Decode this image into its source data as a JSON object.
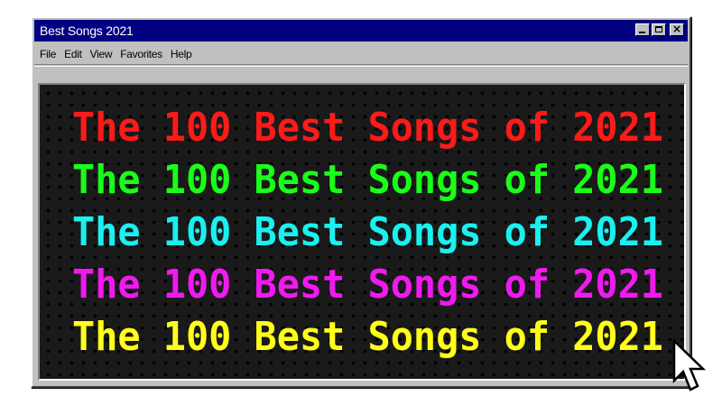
{
  "window": {
    "title": "Best Songs 2021",
    "buttons": [
      "minimize",
      "maximize",
      "close"
    ]
  },
  "menu": [
    "File",
    "Edit",
    "View",
    "Favorites",
    "Help"
  ],
  "display": {
    "lines": [
      {
        "text": "The 100 Best Songs of 2021",
        "color": "#ff1a1a"
      },
      {
        "text": "The 100 Best Songs of 2021",
        "color": "#1aff1a"
      },
      {
        "text": "The 100 Best Songs of 2021",
        "color": "#1af0f0"
      },
      {
        "text": "The 100 Best Songs of 2021",
        "color": "#f01af0"
      },
      {
        "text": "The 100 Best Songs of 2021",
        "color": "#ffff1a"
      }
    ]
  },
  "icons": {
    "cursor": "arrow-pointer-icon"
  }
}
